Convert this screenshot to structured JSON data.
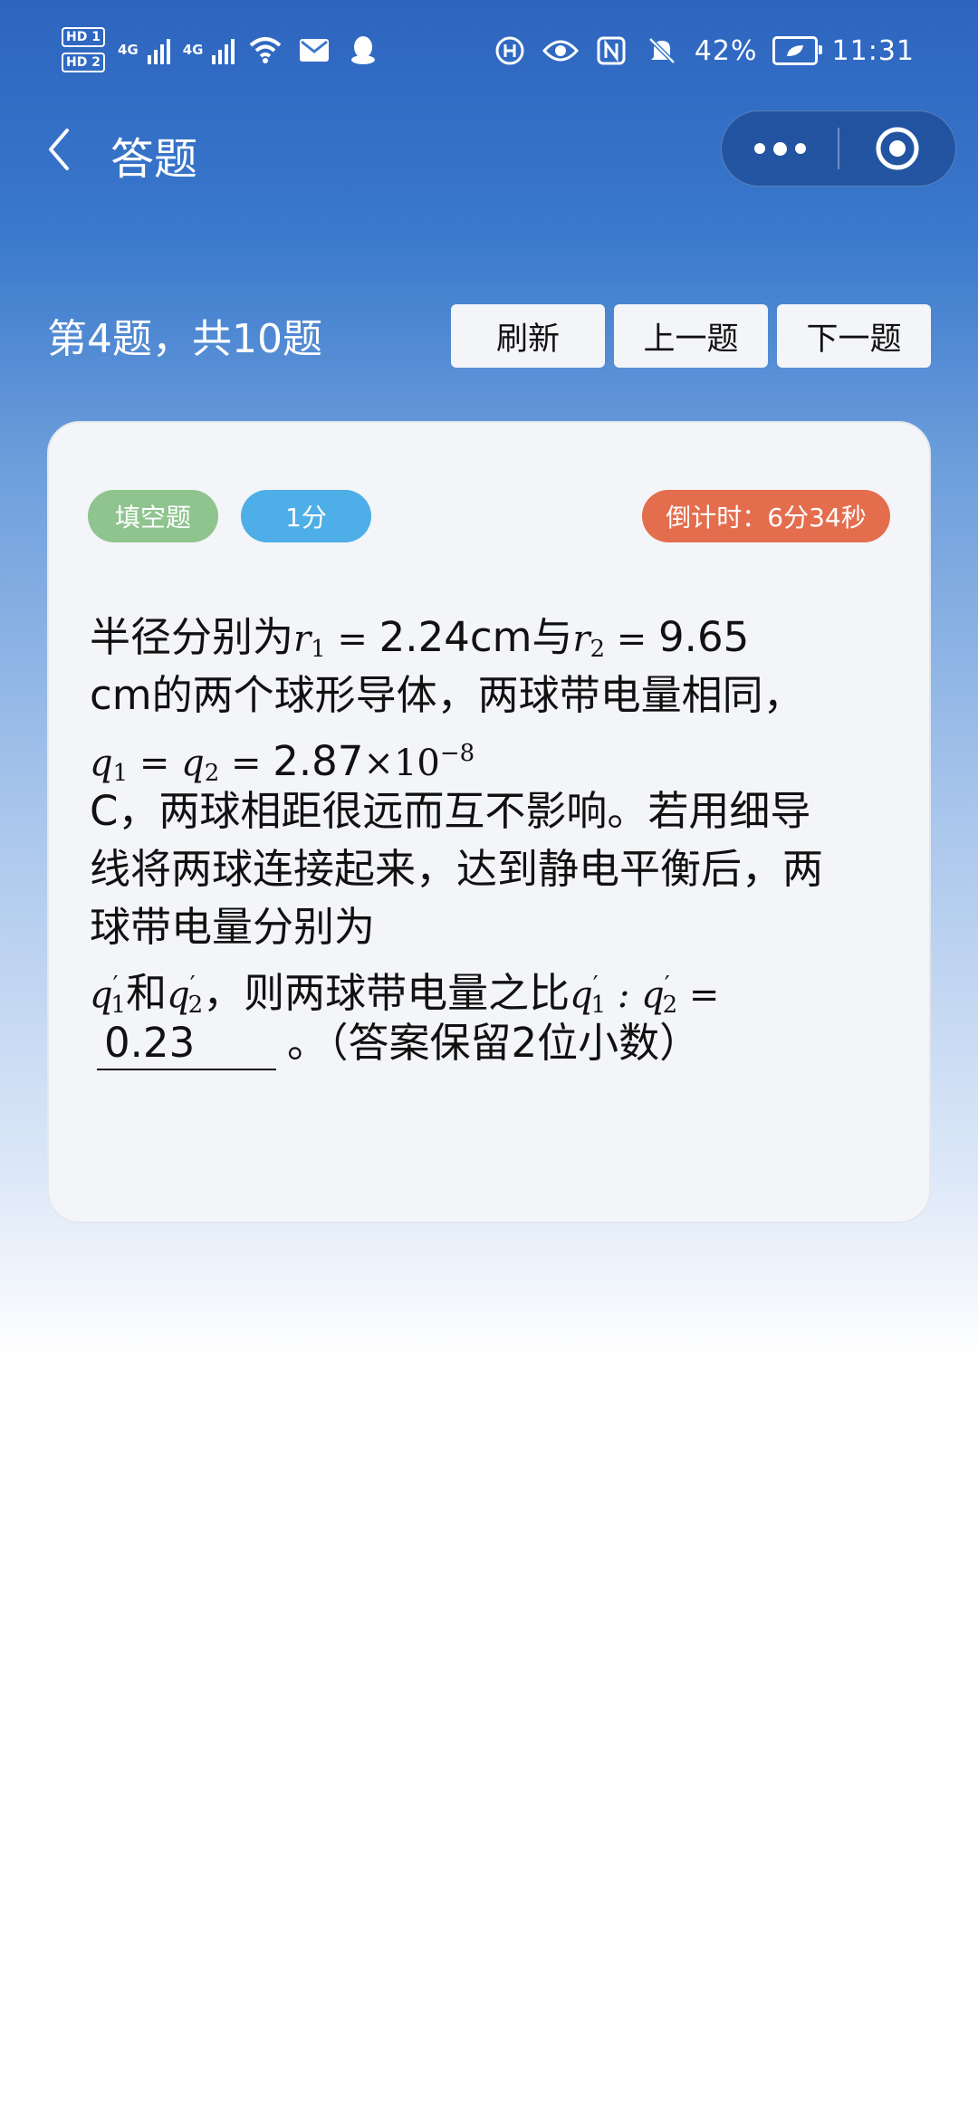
{
  "status_bar": {
    "hd1": "HD 1",
    "hd2": "HD 2",
    "net1": "4G",
    "net2": "4G",
    "battery_percent": "42%",
    "time": "11:31"
  },
  "nav": {
    "title": "答题"
  },
  "header": {
    "progress": "第4题，共10题",
    "refresh_label": "刷新",
    "prev_label": "上一题",
    "next_label": "下一题"
  },
  "card": {
    "type_tag": "填空题",
    "score_tag": "1分",
    "timer": "倒计时：6分34秒",
    "question": {
      "t1": "半径分别为",
      "r1": "r",
      "r1_sub": "1",
      "eq": " = ",
      "r1_val": "2.24cm与",
      "r2": "r",
      "r2_sub": "2",
      "r2_val": "9.65",
      "line2": "cm的两个球形导体，两球带电量相同，",
      "q1": "q",
      "q1_sub": "1",
      "q2": "q",
      "q2_sub": "2",
      "charge_val": "2.87",
      "times": "×10",
      "exp": "−8",
      "line4": "C，两球相距很远而互不影响。若用细导",
      "line5": "线将两球连接起来，达到静电平衡后，两",
      "line6": "球带电量分别为",
      "and": "和",
      "line7_text": "，则两球带电量之比",
      "ratio_colon": " : ",
      "answer": "0.23",
      "suffix": "。（答案保留2位小数）"
    }
  },
  "colors": {
    "type_tag": "#8fc48e",
    "score_tag": "#4eaee7",
    "timer_tag": "#e46d4d",
    "header_blue": "#2d64bf"
  }
}
